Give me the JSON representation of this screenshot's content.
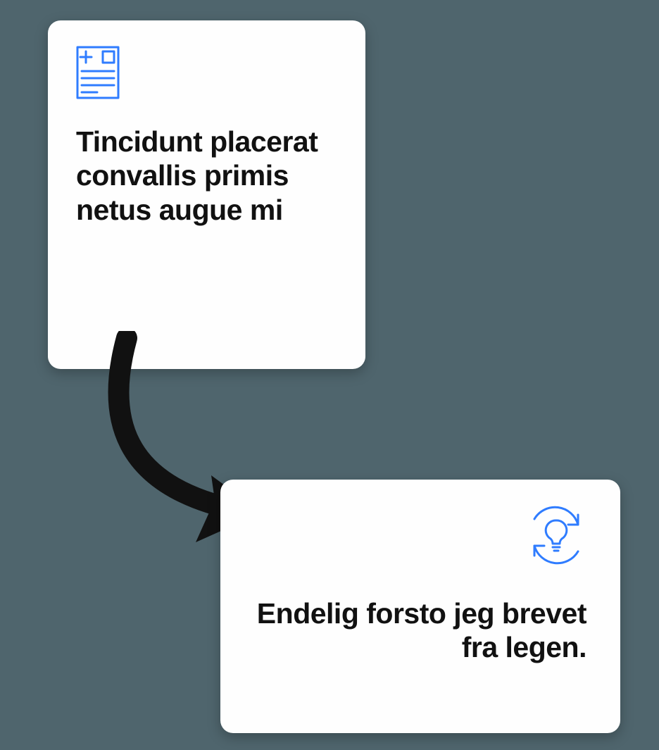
{
  "card1": {
    "icon": "medical-record-icon",
    "heading": "Tincidunt placerat convallis primis netus augue mi"
  },
  "card2": {
    "icon": "lightbulb-refresh-icon",
    "heading": "Endelig forsto jeg brevet fra legen."
  },
  "colors": {
    "accent": "#2f7cff",
    "bg": "#4f656d",
    "card": "#fefefe",
    "text": "#111111",
    "arrow": "#111111"
  }
}
